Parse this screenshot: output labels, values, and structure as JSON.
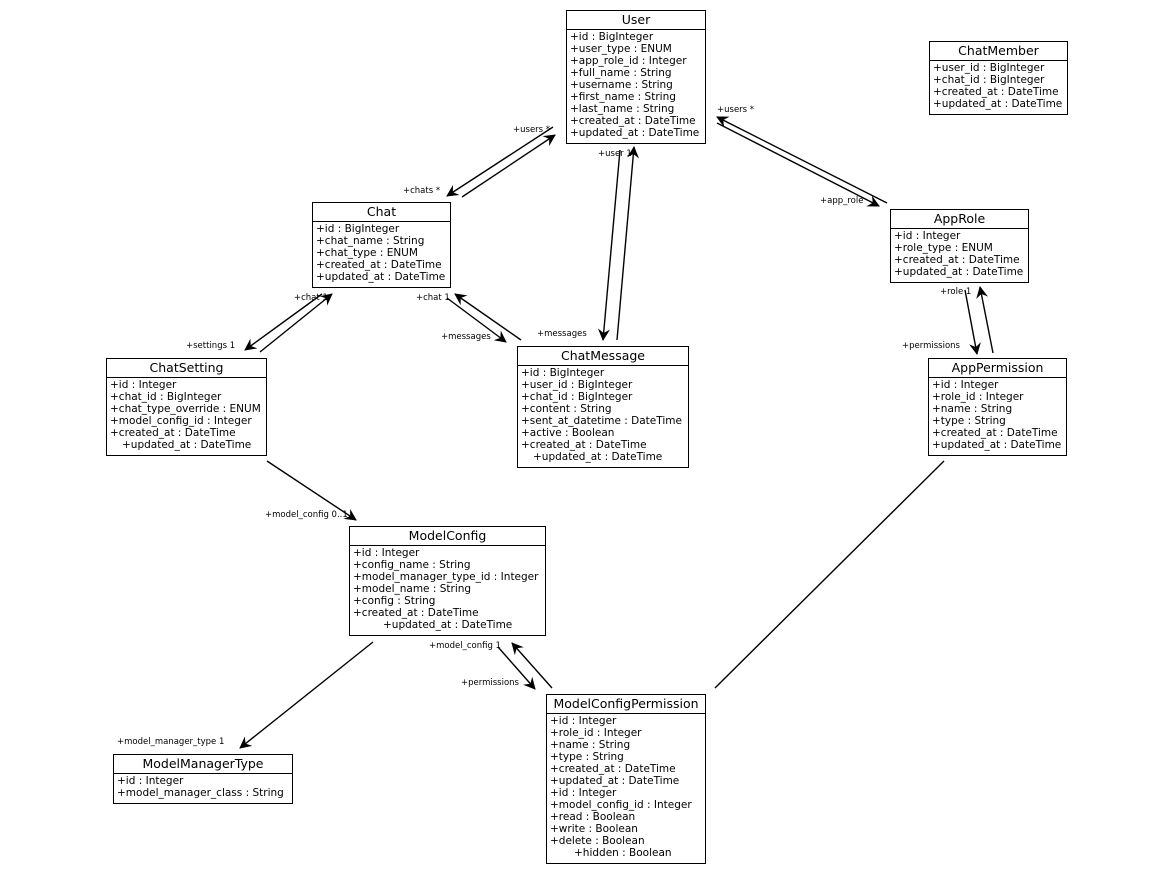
{
  "classes": {
    "user": {
      "name": "User",
      "attributes": [
        "+id : BigInteger",
        "+user_type : ENUM",
        "+app_role_id : Integer",
        "+full_name : String",
        "+username : String",
        "+first_name : String",
        "+last_name : String",
        "+created_at : DateTime",
        "+updated_at : DateTime"
      ]
    },
    "chat_member": {
      "name": "ChatMember",
      "attributes": [
        "+user_id : BigInteger",
        "+chat_id : BigInteger",
        "+created_at : DateTime",
        "+updated_at : DateTime"
      ]
    },
    "chat": {
      "name": "Chat",
      "attributes": [
        "+id : BigInteger",
        "+chat_name : String",
        "+chat_type : ENUM",
        "+created_at : DateTime",
        "+updated_at : DateTime"
      ]
    },
    "app_role": {
      "name": "AppRole",
      "attributes": [
        "+id : Integer",
        "+role_type : ENUM",
        "+created_at : DateTime",
        "+updated_at : DateTime"
      ]
    },
    "chat_setting": {
      "name": "ChatSetting",
      "attributes": [
        "+id : Integer",
        "+chat_id : BigInteger",
        "+chat_type_override : ENUM",
        "+model_config_id : Integer",
        "+created_at : DateTime",
        "+updated_at : DateTime"
      ]
    },
    "chat_message": {
      "name": "ChatMessage",
      "attributes": [
        "+id : BigInteger",
        "+user_id : BigInteger",
        "+chat_id : BigInteger",
        "+content : String",
        "+sent_at_datetime : DateTime",
        "+active : Boolean",
        "+created_at : DateTime",
        "+updated_at : DateTime"
      ]
    },
    "app_permission": {
      "name": "AppPermission",
      "attributes": [
        "+id : Integer",
        "+role_id : Integer",
        "+name : String",
        "+type : String",
        "+created_at : DateTime",
        "+updated_at : DateTime"
      ]
    },
    "model_config": {
      "name": "ModelConfig",
      "attributes": [
        "+id : Integer",
        "+config_name : String",
        "+model_manager_type_id : Integer",
        "+model_name : String",
        "+config : String",
        "+created_at : DateTime",
        "+updated_at : DateTime"
      ]
    },
    "model_config_permission": {
      "name": "ModelConfigPermission",
      "attributes": [
        "+id : Integer",
        "+role_id : Integer",
        "+name : String",
        "+type : String",
        "+created_at : DateTime",
        "+updated_at : DateTime",
        "+id : Integer",
        "+model_config_id : Integer",
        "+read : Boolean",
        "+write : Boolean",
        "+delete : Boolean",
        "+hidden : Boolean"
      ]
    },
    "model_manager_type": {
      "name": "ModelManagerType",
      "attributes": [
        "+id : Integer",
        "+model_manager_class : String"
      ]
    }
  },
  "labels": {
    "users_chat": "+users *",
    "chats": "+chats *",
    "users_role": "+users *",
    "app_role": "+app_role",
    "user_1": "+user 1",
    "messages_user": "+messages",
    "chat_setting_chat": "+chat 1",
    "settings": "+settings 1",
    "chat_msg_chat": "+chat 1",
    "messages_chat": "+messages",
    "role": "+role 1",
    "permissions_role": "+permissions",
    "model_config_setting": "+model_config 0..1",
    "model_config_perm": "+model_config 1",
    "permissions_mc": "+permissions",
    "model_manager_type": "+model_manager_type 1"
  }
}
